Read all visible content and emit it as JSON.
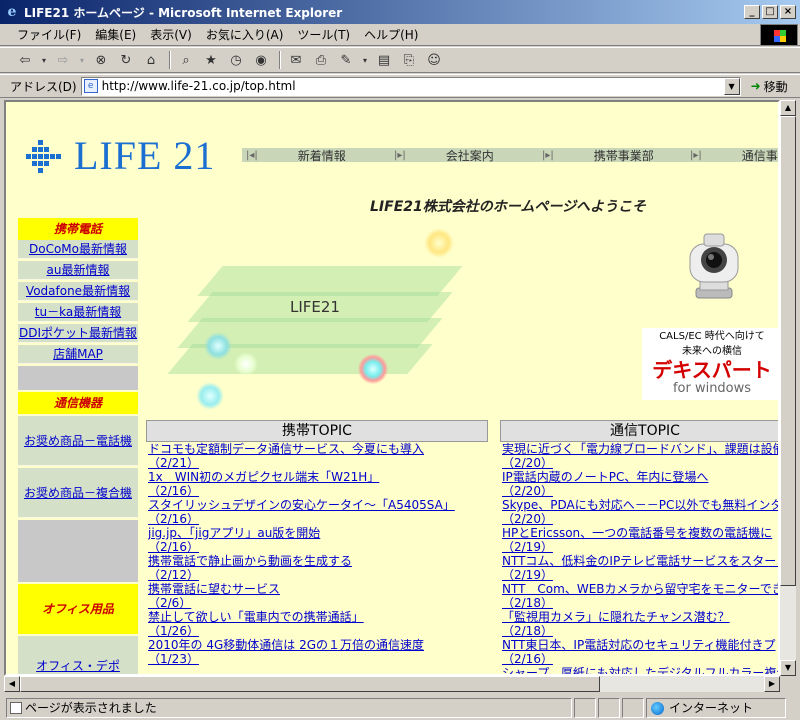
{
  "window": {
    "title": "LIFE21 ホームページ - Microsoft Internet Explorer",
    "controls": [
      "_",
      "□",
      "×"
    ]
  },
  "menu": [
    "ファイル(F)",
    "編集(E)",
    "表示(V)",
    "お気に入り(A)",
    "ツール(T)",
    "ヘルプ(H)"
  ],
  "toolbar": {
    "icons": [
      "back-icon",
      "forward-icon",
      "stop-icon",
      "refresh-icon",
      "home-icon",
      "search-icon",
      "favorites-icon",
      "history-icon",
      "channels-icon",
      "mail-icon",
      "print-icon",
      "edit-icon",
      "discuss-icon",
      "messenger-icon"
    ]
  },
  "address": {
    "label": "アドレス(D)",
    "url": "http://www.life-21.co.jp/top.html",
    "go_label": "移動"
  },
  "status": {
    "text": "ページが表示されました",
    "zone": "インターネット"
  },
  "page": {
    "logo_text": "LIFE 21",
    "nav": [
      "新着情報",
      "会社案内",
      "携帯事業部",
      "通信事"
    ],
    "welcome": "LIFE21株式会社のホームページへようこそ",
    "center_label": "LIFE21",
    "ad": {
      "top_line1": "CALS/EC 時代へ向けて",
      "top_line2": "未来への横信",
      "main": "デキスパート",
      "sub": "for windows"
    },
    "sidebar": {
      "mobile_header": "携帯電話",
      "mobile_links": [
        "DoCoMo最新情報",
        "au最新情報",
        "Vodafone最新情報",
        "tu－ka最新情報",
        "DDIポケット最新情報",
        "店舗MAP"
      ],
      "comm_header": "通信機器",
      "comm_links": [
        "お奨め商品－電話機",
        "お奨め商品－複合機"
      ],
      "office_header": "オフィス用品",
      "office_links": [
        "オフィス・デポ"
      ]
    },
    "mobile_topic": {
      "title": "携帯TOPIC",
      "items": [
        {
          "text": "ドコモも定額制データ通信サービス、今夏にも導入",
          "date": "（2/21）"
        },
        {
          "text": "1x　WIN初のメガピクセル端末「W21H」",
          "date": "（2/16）"
        },
        {
          "text": "スタイリッシュデザインの安心ケータイ～「A5405SA」",
          "date": "（2/16）"
        },
        {
          "text": "jig.jp、「jigアプリ」au版を開始",
          "date": "（2/16）"
        },
        {
          "text": "携帯電話で静止画から動画を生成する",
          "date": "（2/12）"
        },
        {
          "text": "携帯電話に望むサービス",
          "date": "（2/6）"
        },
        {
          "text": "禁止して欲しい「電車内での携帯通話」",
          "date": "（1/26）"
        },
        {
          "text": "2010年の 4G移動体通信は 2Gの１万倍の通信速度",
          "date": "（1/23）"
        }
      ]
    },
    "comm_topic": {
      "title": "通信TOPIC",
      "items": [
        {
          "text": "実現に近づく「電力線ブロードバンド」、課題は設備コ",
          "date": "（2/20）"
        },
        {
          "text": "IP電話内蔵のノートPC、年内に登場へ",
          "date": "（2/20）"
        },
        {
          "text": "Skype、PDAにも対応へ－－PC以外でも無料インタ",
          "date": "（2/20）"
        },
        {
          "text": "HPとEricsson、一つの電話番号を複数の電話機に",
          "date": "（2/19）"
        },
        {
          "text": "NTTコム、低料金のIPテレビ電話サービスをスタート",
          "date": "（2/19）"
        },
        {
          "text": "NTT　Com、WEBカメラから留守宅をモニターできる",
          "date": "（2/18）"
        },
        {
          "text": "「監視用カメラ」に隠れたチャンス潜む？",
          "date": "（2/18）"
        },
        {
          "text": "NTT東日本、IP電話対応のセキュリティ機能付きプ",
          "date": "（2/16）"
        },
        {
          "text": "シャープ、厚紙にも対応したデジタルフルカラー複合機",
          "date": ""
        }
      ]
    }
  }
}
